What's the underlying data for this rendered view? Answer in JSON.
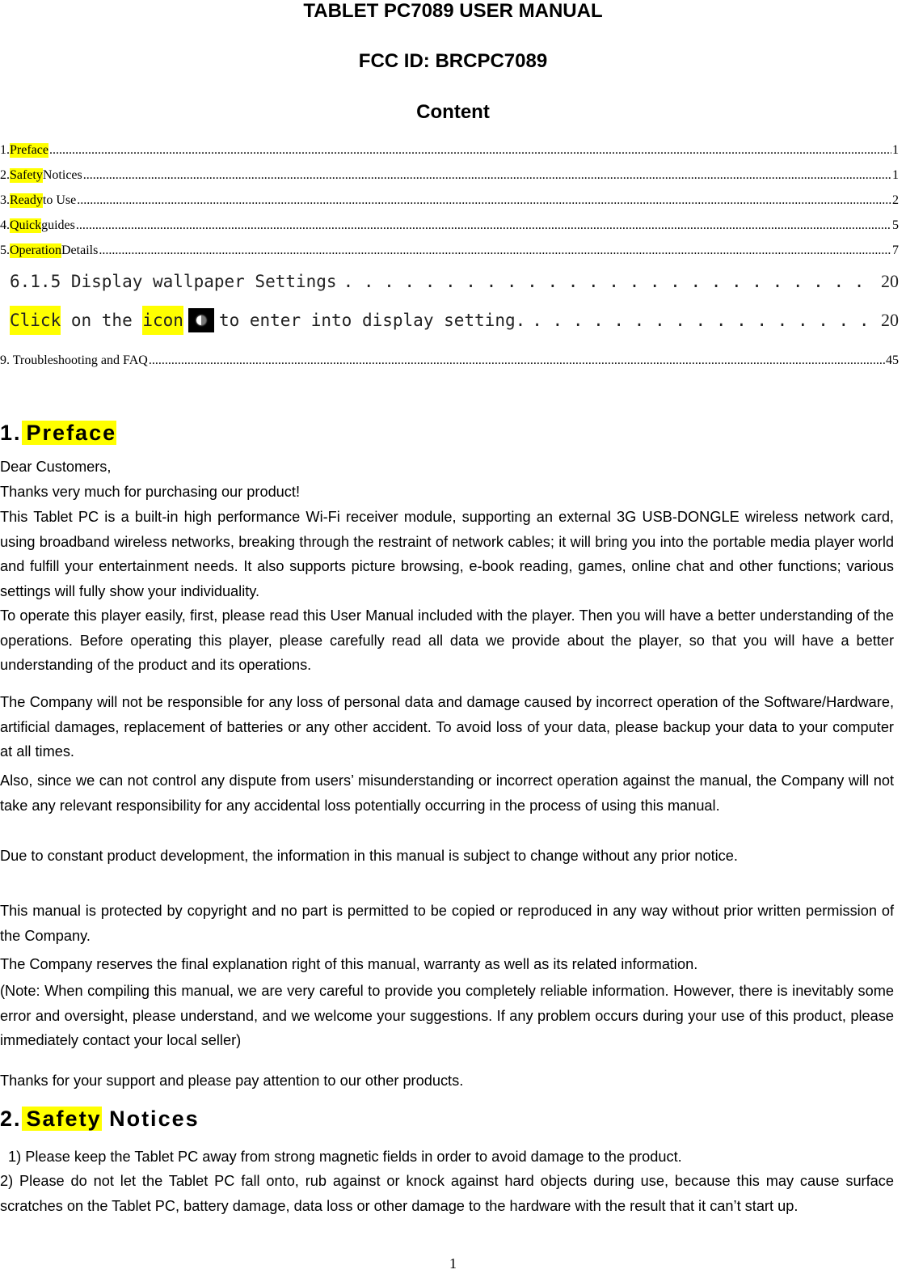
{
  "header": {
    "title": "TABLET PC7089 USER MANUAL",
    "fcc_id": "FCC ID: BRCPC7089",
    "content_heading": "Content"
  },
  "toc": {
    "items": [
      {
        "num": "1.",
        "highlight": "Preface",
        "rest": "",
        "page": "1"
      },
      {
        "num": "2.",
        "highlight": "Safety",
        "rest": " Notices ",
        "page": "1"
      },
      {
        "num": "3.",
        "highlight": "Ready",
        "rest": " to Use ",
        "page": "2"
      },
      {
        "num": "4.",
        "highlight": "Quick",
        "rest": " guides",
        "page": "5"
      },
      {
        "num": "5.",
        "highlight": "Operation",
        "rest": " Details",
        "page": "7"
      }
    ],
    "sub_item": {
      "label": "6.1.5 Display wallpaper Settings",
      "page": "20"
    },
    "click_item": {
      "word1": "Click",
      "middle": " on the ",
      "word2": "icon",
      "icon": "display-settings-icon",
      "rest": " to enter into display setting.",
      "page": "20"
    },
    "last_item": {
      "label": "9. Troubleshooting and FAQ ",
      "page": "45"
    }
  },
  "preface": {
    "num": "1.",
    "title": "Preface",
    "paragraphs": [
      "Dear Customers,",
      "Thanks very much for purchasing our product!",
      "This Tablet PC is a built-in high performance Wi-Fi receiver module, supporting an external 3G USB-DONGLE wireless network card, using broadband wireless networks, breaking through the restraint of network cables; it will bring you into the portable media player world and fulfill your entertainment needs. It also supports picture browsing, e-book reading, games, online chat and other functions; various settings will fully show your individuality.",
      "To operate this player easily, first, please read this User Manual included with the player. Then you will have a better understanding of the operations. Before operating this player, please carefully read all data we provide about the player, so that you will have a better understanding of the product and its operations.",
      "The Company will not be responsible for any loss of personal data and damage caused by incorrect operation of the Software/Hardware, artificial damages, replacement of batteries or any other accident. To avoid loss of your data, please backup your data to your computer at all times.",
      "Also, since we can not control any dispute from users’ misunderstanding or incorrect operation against the manual, the Company will not take any relevant responsibility for any accidental loss potentially occurring in the process of using this manual.",
      "Due to constant product development, the information in this manual is subject to change without any prior notice.",
      "This manual is protected by copyright and no part is permitted to be copied or reproduced in any way without prior written permission of the Company.",
      "The Company reserves the final explanation right of this manual, warranty as well as its related information.",
      "(Note: When compiling this manual, we are very careful to provide you completely reliable information. However, there is inevitably some error and oversight, please understand, and we welcome your suggestions. If any problem occurs during your use of this product, please immediately contact your local seller)",
      "Thanks for your support and please pay attention to our other products."
    ]
  },
  "safety": {
    "num": "2.",
    "title_highlight": "Safety",
    "title_rest": " Notices",
    "items": [
      "1) Please keep the Tablet PC away from strong magnetic fields in order to avoid damage to the product.",
      "2) Please do not let the Tablet PC fall onto, rub against or knock against hard objects during use, because this may cause surface scratches on the Tablet PC, battery damage, data loss or other damage to the hardware with the result that it can’t start up."
    ]
  },
  "footer": {
    "page_number": "1"
  },
  "colors": {
    "highlight": "#ffff00",
    "text": "#000000"
  }
}
